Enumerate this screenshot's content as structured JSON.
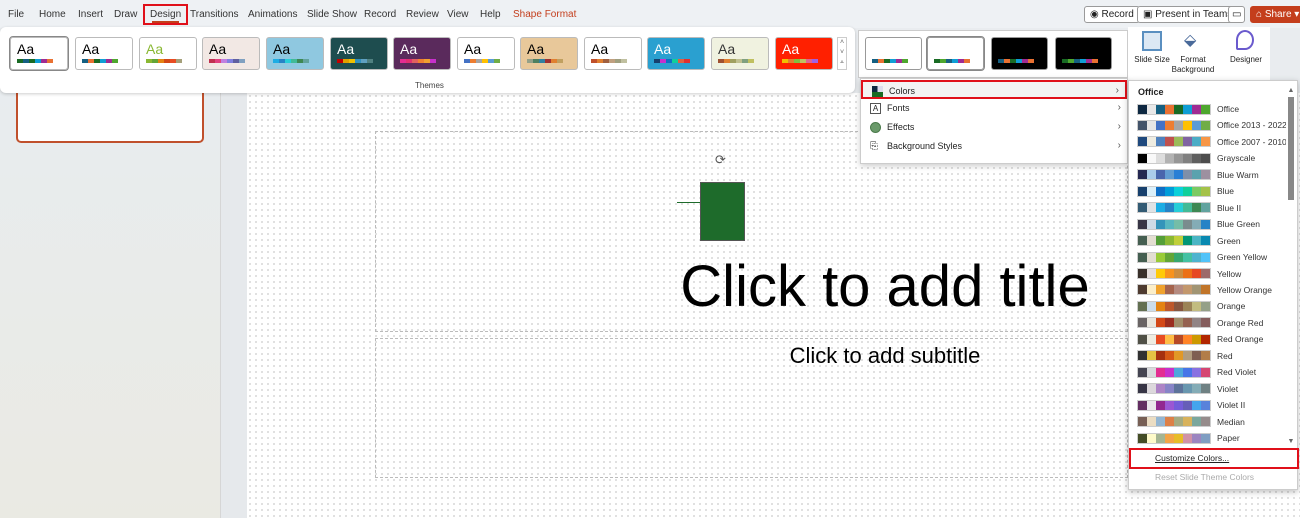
{
  "tabs": [
    "File",
    "Home",
    "Insert",
    "Draw",
    "Design",
    "Transitions",
    "Animations",
    "Slide Show",
    "Record",
    "Review",
    "View",
    "Help",
    "Shape Format"
  ],
  "active_tab": "Design",
  "top_buttons": {
    "record": "Record",
    "present": "Present in Teams",
    "share": "Share"
  },
  "themes_label": "Themes",
  "themes": [
    {
      "bg": "#ffffff",
      "fg": "#000",
      "sw": [
        "#196b24",
        "#156082",
        "#196b24",
        "#0f9ed5",
        "#a02b93",
        "#e97132"
      ]
    },
    {
      "bg": "#ffffff",
      "fg": "#000",
      "sw": [
        "#156082",
        "#e97132",
        "#196b24",
        "#0f9ed5",
        "#a02b93",
        "#4ea72e"
      ]
    },
    {
      "bg": "#ffffff",
      "fg": "#8ab833",
      "sw": [
        "#8ab833",
        "#63a537",
        "#e48312",
        "#d34817",
        "#e84c22",
        "#a5a07a"
      ]
    },
    {
      "bg": "#f2e8e4",
      "fg": "#000",
      "sw": [
        "#c0304f",
        "#e0407f",
        "#c080e0",
        "#8080e0",
        "#6060a0",
        "#80a0c0"
      ]
    },
    {
      "bg": "#8fc8e0",
      "fg": "#000",
      "sw": [
        "#1cade4",
        "#2683c6",
        "#27ced7",
        "#42ba97",
        "#3e8853",
        "#62a39f"
      ]
    },
    {
      "bg": "#1e4d4f",
      "fg": "#fff",
      "sw": [
        "#c00000",
        "#e0a000",
        "#f0c000",
        "#3090c0",
        "#60a0c0",
        "#508080"
      ]
    },
    {
      "bg": "#5a2a5c",
      "fg": "#fff",
      "sw": [
        "#e32d91",
        "#e03070",
        "#e06060",
        "#f08030",
        "#f0a030",
        "#c830cc"
      ]
    },
    {
      "bg": "#ffffff",
      "fg": "#000",
      "sw": [
        "#4472c4",
        "#ed7d31",
        "#a5a5a5",
        "#ffc000",
        "#5b9bd5",
        "#70ad47"
      ]
    },
    {
      "bg": "#e8c89a",
      "fg": "#000",
      "sw": [
        "#94a088",
        "#4e8060",
        "#3080a0",
        "#a03030",
        "#e08030",
        "#c0a060"
      ]
    },
    {
      "bg": "#ffffff",
      "fg": "#000",
      "sw": [
        "#c0502c",
        "#e08030",
        "#a06040",
        "#c0a080",
        "#a0a080",
        "#c0c0a0"
      ]
    },
    {
      "bg": "#2aa0d0",
      "fg": "#fff",
      "sw": [
        "#17406d",
        "#c830cc",
        "#0f6fc6",
        "#10cf9b",
        "#e06040",
        "#e03030"
      ]
    },
    {
      "bg": "#f0f2e0",
      "fg": "#333",
      "sw": [
        "#a05030",
        "#e08030",
        "#a0a060",
        "#c0c090",
        "#80a080",
        "#c0c060"
      ]
    },
    {
      "bg": "#ff2000",
      "fg": "#fff",
      "sw": [
        "#f0c000",
        "#e08030",
        "#80c040",
        "#c0c060",
        "#e06090",
        "#a060e0"
      ]
    }
  ],
  "variants": [
    {
      "bg": "#ffffff",
      "sw": [
        "#156082",
        "#e97132",
        "#196b24",
        "#0f9ed5",
        "#a02b93",
        "#4ea72e"
      ]
    },
    {
      "bg": "#ffffff",
      "sw": [
        "#196b24",
        "#4ea72e",
        "#156082",
        "#0f9ed5",
        "#a02b93",
        "#e97132"
      ]
    },
    {
      "bg": "#000000",
      "sw": [
        "#156082",
        "#e97132",
        "#196b24",
        "#0f9ed5",
        "#a02b93",
        "#e97132"
      ]
    },
    {
      "bg": "#000000",
      "sw": [
        "#196b24",
        "#4ea72e",
        "#156082",
        "#0f9ed5",
        "#a02b93",
        "#e97132"
      ]
    }
  ],
  "ribbon_buttons": {
    "slide_size": "Slide Size",
    "format_background": "Format Background",
    "designer": "Designer"
  },
  "slide": {
    "title": "Click to add title",
    "subtitle": "Click to add subtitle",
    "shape_color": "#1e6b2b"
  },
  "variants_menu": [
    {
      "label": "Colors",
      "icon": "colors-icon",
      "selected": true
    },
    {
      "label": "Fonts",
      "icon": "fonts-icon"
    },
    {
      "label": "Effects",
      "icon": "effects-icon"
    },
    {
      "label": "Background Styles",
      "icon": "background-styles-icon"
    }
  ],
  "colors_gallery": {
    "heading": "Office",
    "customize": "Customize Colors...",
    "reset": "Reset Slide Theme Colors",
    "palettes": [
      {
        "name": "Office",
        "c": [
          "#0e2841",
          "#e8e8e8",
          "#156082",
          "#e97132",
          "#196b24",
          "#0f9ed5",
          "#a02b93",
          "#4ea72e"
        ]
      },
      {
        "name": "Office 2013 - 2022",
        "c": [
          "#44546a",
          "#e7e6e6",
          "#4472c4",
          "#ed7d31",
          "#a5a5a5",
          "#ffc000",
          "#5b9bd5",
          "#70ad47"
        ]
      },
      {
        "name": "Office 2007 - 2010",
        "c": [
          "#1f497d",
          "#eeece1",
          "#4f81bd",
          "#c0504d",
          "#9bbb59",
          "#8064a2",
          "#4bacc6",
          "#f79646"
        ]
      },
      {
        "name": "Grayscale",
        "c": [
          "#000000",
          "#f8f8f8",
          "#dddddd",
          "#b2b2b2",
          "#969696",
          "#808080",
          "#5f5f5f",
          "#4d4d4d"
        ]
      },
      {
        "name": "Blue Warm",
        "c": [
          "#242852",
          "#acccea",
          "#4a66ac",
          "#629dd1",
          "#297fd5",
          "#7f8fa9",
          "#5aa2ae",
          "#9d90a0"
        ]
      },
      {
        "name": "Blue",
        "c": [
          "#17406d",
          "#dbeff9",
          "#0f6fc6",
          "#009dd9",
          "#0bd0d9",
          "#10cf9b",
          "#7cca62",
          "#a5c249"
        ]
      },
      {
        "name": "Blue II",
        "c": [
          "#335b74",
          "#dfe3e5",
          "#1cade4",
          "#2683c6",
          "#27ced7",
          "#42ba97",
          "#3e8853",
          "#62a39f"
        ]
      },
      {
        "name": "Blue Green",
        "c": [
          "#373545",
          "#cedbe6",
          "#3494ba",
          "#58b6c0",
          "#75bda7",
          "#7a8c8e",
          "#84acb6",
          "#2683c6"
        ]
      },
      {
        "name": "Green",
        "c": [
          "#455f51",
          "#e3ded1",
          "#549e39",
          "#8ab833",
          "#c0cf3a",
          "#029676",
          "#4ab5c4",
          "#0989b1"
        ]
      },
      {
        "name": "Green Yellow",
        "c": [
          "#455f51",
          "#e3ded1",
          "#99cb38",
          "#63a537",
          "#37a76f",
          "#44c1a3",
          "#4eb3cf",
          "#51c3f9"
        ]
      },
      {
        "name": "Yellow",
        "c": [
          "#39302a",
          "#e5dedb",
          "#ffca08",
          "#f8931d",
          "#ce8d3e",
          "#ec7016",
          "#e64823",
          "#9c6a6a"
        ]
      },
      {
        "name": "Yellow Orange",
        "c": [
          "#4e3b30",
          "#fbeec9",
          "#f0a22e",
          "#a5644e",
          "#b58b80",
          "#c3986d",
          "#a19574",
          "#c17529"
        ]
      },
      {
        "name": "Orange",
        "c": [
          "#637052",
          "#ccddea",
          "#e48312",
          "#bd582c",
          "#865640",
          "#9b8357",
          "#c2bc80",
          "#94a088"
        ]
      },
      {
        "name": "Orange Red",
        "c": [
          "#696464",
          "#e9e5dc",
          "#d34817",
          "#9b2d1f",
          "#a28e6a",
          "#956251",
          "#918485",
          "#855d5d"
        ]
      },
      {
        "name": "Red Orange",
        "c": [
          "#505046",
          "#eeece1",
          "#e84c22",
          "#ffbd47",
          "#b64926",
          "#ff8427",
          "#cc9900",
          "#b22600"
        ]
      },
      {
        "name": "Red",
        "c": [
          "#323232",
          "#e5c243",
          "#a5300f",
          "#d55816",
          "#e19825",
          "#b19c7d",
          "#7f5f52",
          "#b27d49"
        ]
      },
      {
        "name": "Red Violet",
        "c": [
          "#454551",
          "#d8d9dc",
          "#e32d91",
          "#c830cc",
          "#4ea6dc",
          "#4775e7",
          "#8971e1",
          "#d54773"
        ]
      },
      {
        "name": "Violet",
        "c": [
          "#373545",
          "#dcd8dc",
          "#ad84c6",
          "#8784c7",
          "#5d739a",
          "#6997af",
          "#84acb6",
          "#6f8183"
        ]
      },
      {
        "name": "Violet II",
        "c": [
          "#632e62",
          "#eae5eb",
          "#92278f",
          "#9b57d3",
          "#755dd9",
          "#665eb8",
          "#45a5ed",
          "#5982db"
        ]
      },
      {
        "name": "Median",
        "c": [
          "#775f55",
          "#ebddc3",
          "#94b6d2",
          "#dd8047",
          "#a5ab81",
          "#d8b25c",
          "#7ba79d",
          "#968c8c"
        ]
      },
      {
        "name": "Paper",
        "c": [
          "#444d26",
          "#fefac9",
          "#a5b592",
          "#f3a447",
          "#e7bc29",
          "#d092a7",
          "#9c85c0",
          "#809ec2"
        ]
      }
    ]
  },
  "colors": {
    "accent": "#c43e1c",
    "highlight": "#e0101a",
    "shape_format": "#c43e1c"
  }
}
